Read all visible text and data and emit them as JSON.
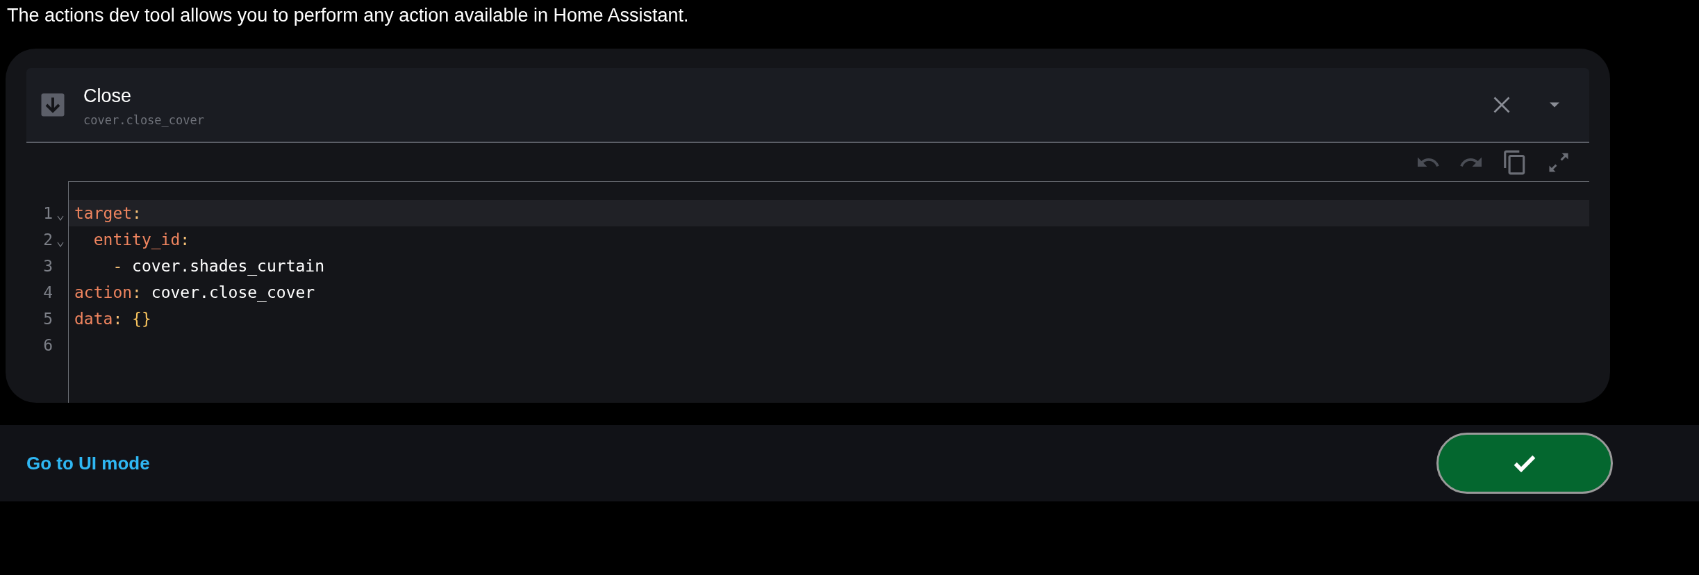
{
  "intro": "The actions dev tool allows you to perform any action available in Home Assistant.",
  "action": {
    "title": "Close",
    "service": "cover.close_cover"
  },
  "code_lines": [
    {
      "number": "1",
      "foldable": true,
      "active": true,
      "tokens": [
        {
          "kind": "key",
          "text": "target"
        },
        {
          "kind": "punct",
          "text": ":"
        }
      ]
    },
    {
      "number": "2",
      "foldable": true,
      "active": false,
      "tokens": [
        {
          "kind": "key",
          "text": "  entity_id"
        },
        {
          "kind": "punct",
          "text": ":"
        }
      ]
    },
    {
      "number": "3",
      "foldable": false,
      "active": false,
      "tokens": [
        {
          "kind": "dash",
          "text": "    -"
        },
        {
          "kind": "value",
          "text": " cover.shades_curtain"
        }
      ]
    },
    {
      "number": "4",
      "foldable": false,
      "active": false,
      "tokens": [
        {
          "kind": "key",
          "text": "action"
        },
        {
          "kind": "punct",
          "text": ":"
        },
        {
          "kind": "value",
          "text": " cover.close_cover"
        }
      ]
    },
    {
      "number": "5",
      "foldable": false,
      "active": false,
      "tokens": [
        {
          "kind": "key",
          "text": "data"
        },
        {
          "kind": "punct",
          "text": ": "
        },
        {
          "kind": "brace",
          "text": "{}"
        }
      ]
    },
    {
      "number": "6",
      "foldable": false,
      "active": false
    }
  ],
  "footer": {
    "link": "Go to UI mode"
  }
}
